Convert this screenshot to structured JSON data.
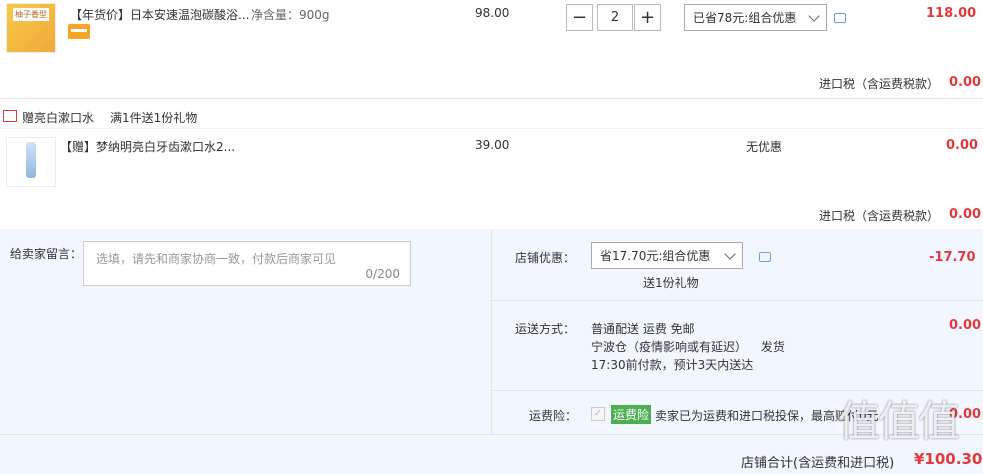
{
  "item1": {
    "tag": "【年货价】",
    "name": "日本安速温泡碳酸浴...",
    "spec": "净含量：900g",
    "price": "98.00",
    "qty": "2",
    "promo": "已省78元:组合优惠",
    "subtotal": "118.00",
    "thumb_text": "柚子香型"
  },
  "tax1": {
    "label": "进口税（含运费税款）",
    "value": "0.00"
  },
  "gift_header": {
    "title": "赠亮白漱口水",
    "desc": "满1件送1份礼物"
  },
  "item2": {
    "name": "【赠】梦纳明亮白牙齿漱口水2...",
    "price": "39.00",
    "promo": "无优惠",
    "subtotal": "0.00"
  },
  "tax2": {
    "label": "进口税（含运费税款）",
    "value": "0.00"
  },
  "note": {
    "label": "给卖家留言：",
    "placeholder": "选填，请先和商家协商一致，付款后商家可见",
    "counter": "0/200"
  },
  "discount": {
    "label": "店铺优惠：",
    "selected": "省17.70元:组合优惠",
    "gift": "送1份礼物",
    "value": "-17.70"
  },
  "shipping": {
    "label": "运送方式：",
    "line1": "普通配送 运费 免邮",
    "line2a": "宁波仓（疫情影响或有延迟）",
    "line2b": "发货",
    "line3": "17:30前付款，预计3天内送达",
    "value": "0.00"
  },
  "insurance": {
    "label": "运费险：",
    "badge": "运费险",
    "text": "卖家已为运费和进口税投保，最高赔付0元",
    "value": "0.00"
  },
  "total": {
    "label": "店铺合计(含运费和进口税)",
    "value": "¥100.30"
  },
  "watermark": "值值值",
  "colors": {
    "price_red": "#e4393c",
    "panel_bg": "#f2f7ff",
    "badge_green": "#4caf50"
  }
}
